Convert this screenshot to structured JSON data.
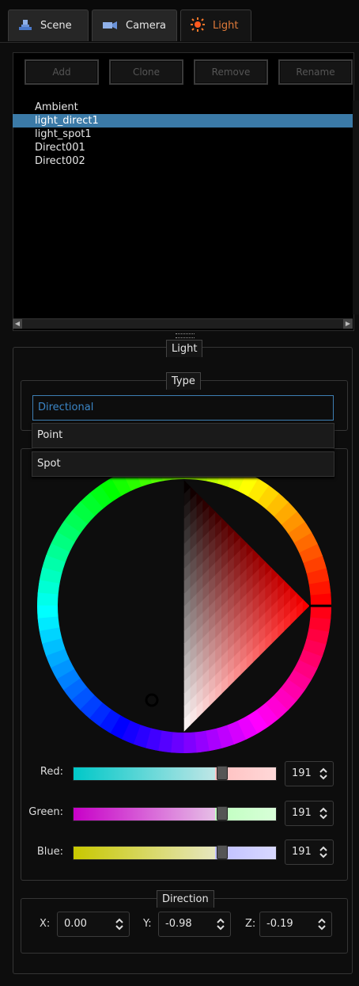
{
  "tabs": [
    {
      "label": "Scene",
      "icon": "scene-icon"
    },
    {
      "label": "Camera",
      "icon": "camera-icon"
    },
    {
      "label": "Light",
      "icon": "light-icon",
      "active": true
    }
  ],
  "toolbar": {
    "add": "Add",
    "clone": "Clone",
    "remove": "Remove",
    "rename": "Rename"
  },
  "lights": [
    "Ambient",
    "light_direct1",
    "light_spot1",
    "Direct001",
    "Direct002"
  ],
  "selected_light": "light_direct1",
  "light_group": {
    "title": "Light"
  },
  "type_group": {
    "title": "Type",
    "value": "Directional",
    "options": [
      "Point",
      "Spot"
    ]
  },
  "color": {
    "red": {
      "label": "Red:",
      "value": "191",
      "fraction": 0.75
    },
    "green": {
      "label": "Green:",
      "value": "191",
      "fraction": 0.75
    },
    "blue": {
      "label": "Blue:",
      "value": "191",
      "fraction": 0.75
    }
  },
  "direction": {
    "title": "Direction",
    "x": {
      "label": "X:",
      "value": "0.00"
    },
    "y": {
      "label": "Y:",
      "value": "-0.98"
    },
    "z": {
      "label": "Z:",
      "value": "-0.19"
    }
  },
  "colors": {
    "accent": "#3b7aa7",
    "active_tab": "#e07a3a"
  }
}
